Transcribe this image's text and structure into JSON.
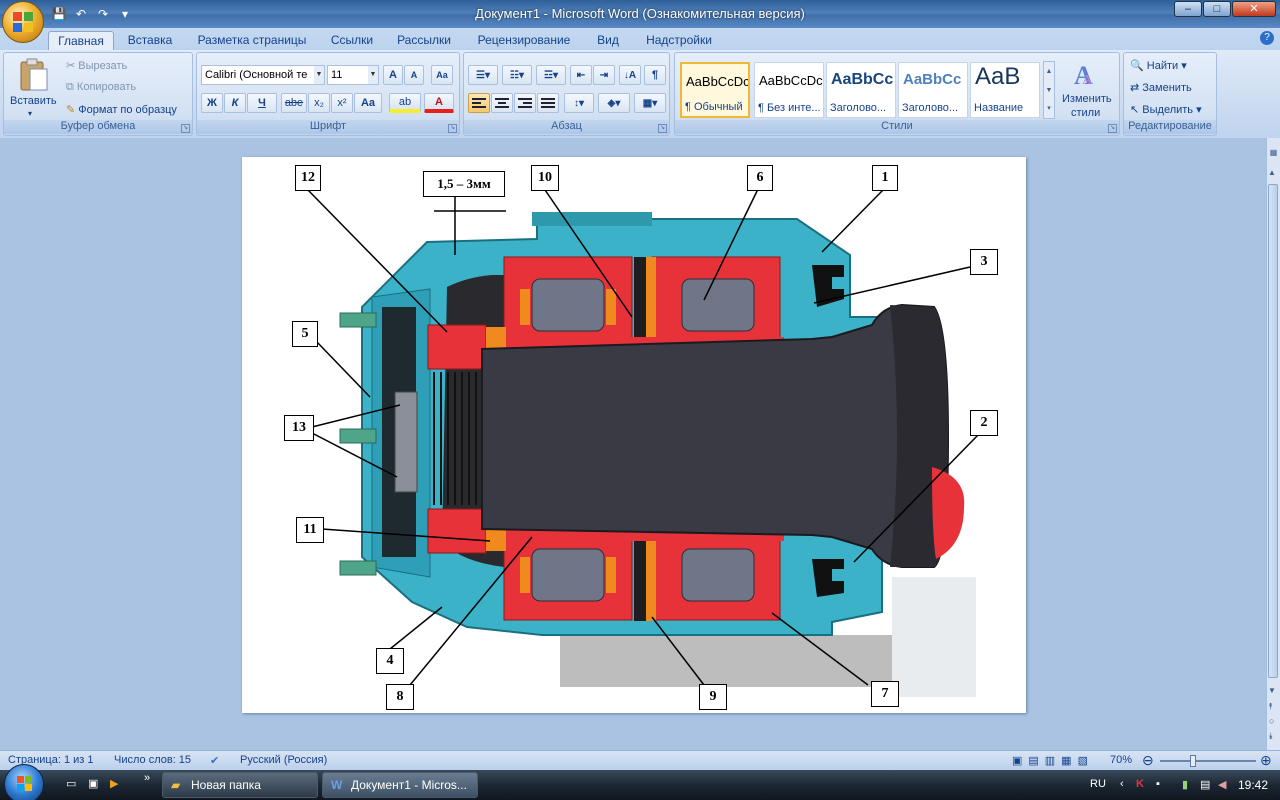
{
  "window": {
    "title": "Документ1 - Microsoft Word (Ознакомительная версия)",
    "minimize": "–",
    "maximize": "□",
    "close": "✕"
  },
  "quick_access": {
    "save": "💾",
    "undo": "↶",
    "redo": "↷",
    "customize": "▾"
  },
  "tabs": [
    "Главная",
    "Вставка",
    "Разметка страницы",
    "Ссылки",
    "Рассылки",
    "Рецензирование",
    "Вид",
    "Надстройки"
  ],
  "active_tab": 0,
  "help": "?",
  "ribbon": {
    "clipboard": {
      "label": "Буфер обмена",
      "paste": "Вставить",
      "cut": "Вырезать",
      "copy": "Копировать",
      "format_painter": "Формат по образцу"
    },
    "font": {
      "label": "Шрифт",
      "family": "Calibri (Основной те",
      "size": "11",
      "grow": "A",
      "shrink": "A",
      "clear": "Aa",
      "bold": "Ж",
      "italic": "К",
      "underline": "Ч",
      "strike": "abe",
      "subscript": "x₂",
      "superscript": "x²",
      "case": "Aa",
      "highlight": "ab",
      "color": "A"
    },
    "paragraph": {
      "label": "Абзац",
      "pilcrow": "¶"
    },
    "styles": {
      "label": "Стили",
      "change": "Изменить",
      "change2": "стили",
      "items": [
        {
          "preview": "AaBbCcDc",
          "name": "¶ Обычный"
        },
        {
          "preview": "AaBbCcDc",
          "name": "¶ Без инте..."
        },
        {
          "preview": "AaBbCc",
          "name": "Заголово..."
        },
        {
          "preview": "AaBbCc",
          "name": "Заголово..."
        },
        {
          "preview": "AaB",
          "name": "Название"
        }
      ]
    },
    "editing": {
      "label": "Редактирование",
      "find": "Найти",
      "replace": "Заменить",
      "select": "Выделить"
    }
  },
  "document": {
    "callouts": [
      "12",
      "1,5 – 3мм",
      "10",
      "6",
      "1",
      "3",
      "5",
      "13",
      "2",
      "11",
      "4",
      "8",
      "9",
      "7"
    ]
  },
  "status": {
    "page": "Страница: 1 из 1",
    "words": "Число слов: 15",
    "language": "Русский (Россия)",
    "zoom": "70%"
  },
  "taskbar": {
    "folder": "Новая папка",
    "word": "Документ1 - Micros...",
    "lang": "RU",
    "time": "19:42"
  },
  "colors": {
    "housing": "#3cb2c8",
    "bearing_red": "#e8323a",
    "shaft": "#3a3a44",
    "seal_orange": "#f08a1e"
  }
}
